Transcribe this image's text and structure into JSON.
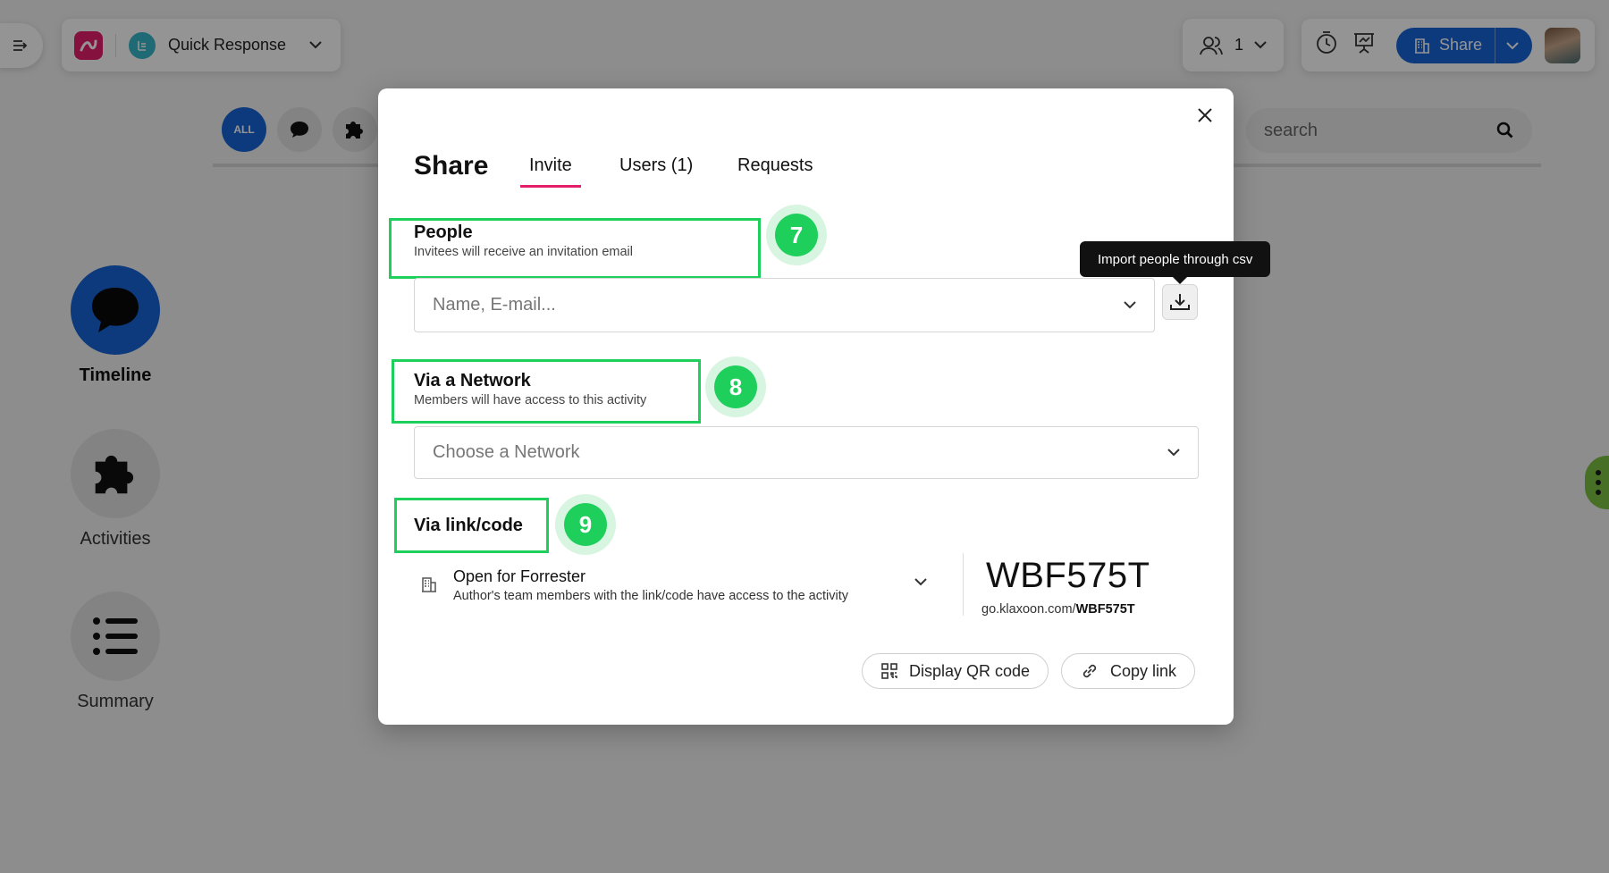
{
  "app": {
    "activity_title": "Quick Response",
    "participants_count": "1",
    "share_label": "Share",
    "search_placeholder": "search",
    "filter_all": "ALL",
    "nav": {
      "timeline": "Timeline",
      "activities": "Activities",
      "summary": "Summary"
    },
    "colors": {
      "primary": "#1565d8",
      "brand": "#e51e6b",
      "highlight": "#1fcf5c"
    }
  },
  "modal": {
    "title": "Share",
    "tabs": [
      "Invite",
      "Users (1)",
      "Requests"
    ],
    "people": {
      "title": "People",
      "subtitle": "Invitees will receive an invitation email",
      "placeholder": "Name, E-mail...",
      "badge": "7",
      "tooltip": "Import people through csv"
    },
    "network": {
      "title": "Via a Network",
      "subtitle": "Members will have access to this activity",
      "placeholder": "Choose a Network",
      "badge": "8"
    },
    "link": {
      "title": "Via link/code",
      "badge": "9",
      "option_title": "Open for Forrester",
      "option_subtitle": "Author's team members with the link/code have access to the activity",
      "code": "WBF575T",
      "url_prefix": "go.klaxoon.com/",
      "url_code": "WBF575T"
    },
    "buttons": {
      "qr": "Display QR code",
      "copy": "Copy link"
    }
  }
}
